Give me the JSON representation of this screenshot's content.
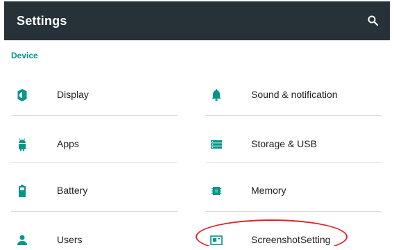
{
  "appbar": {
    "title": "Settings",
    "search_icon": "search-icon",
    "background": "#263238"
  },
  "section": {
    "title": "Device",
    "color": "#009688"
  },
  "items": [
    {
      "label": "Display",
      "icon": "brightness-icon"
    },
    {
      "label": "Sound & notification",
      "icon": "bell-icon"
    },
    {
      "label": "Apps",
      "icon": "android-icon"
    },
    {
      "label": "Storage & USB",
      "icon": "storage-icon"
    },
    {
      "label": "Battery",
      "icon": "battery-icon"
    },
    {
      "label": "Memory",
      "icon": "memory-chip-icon"
    },
    {
      "label": "Users",
      "icon": "person-icon"
    },
    {
      "label": "ScreenshotSetting",
      "icon": "screenshot-icon"
    }
  ],
  "annotation": {
    "color": "#e02020"
  }
}
